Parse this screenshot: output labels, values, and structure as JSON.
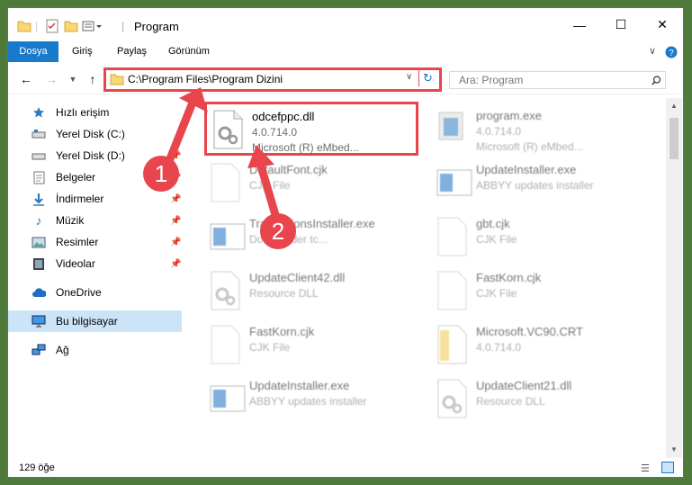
{
  "window": {
    "title": "Program"
  },
  "ribbon": {
    "tabs": [
      "Dosya",
      "Giriş",
      "Paylaş",
      "Görünüm"
    ]
  },
  "address": {
    "path": "C:\\Program Files\\Program Dizini"
  },
  "search": {
    "placeholder": "Ara: Program"
  },
  "sidebar": {
    "items": [
      {
        "label": "Hızlı erişim",
        "icon": "star-icon"
      },
      {
        "label": "Yerel Disk (C:)",
        "icon": "drive-icon"
      },
      {
        "label": "Yerel Disk (D:)",
        "icon": "drive-icon"
      },
      {
        "label": "Belgeler",
        "icon": "documents-icon"
      },
      {
        "label": "İndirmeler",
        "icon": "download-icon"
      },
      {
        "label": "Müzik",
        "icon": "music-icon"
      },
      {
        "label": "Resimler",
        "icon": "pictures-icon"
      },
      {
        "label": "Videolar",
        "icon": "video-icon"
      },
      {
        "label": "OneDrive",
        "icon": "cloud-icon"
      },
      {
        "label": "Bu bilgisayar",
        "icon": "computer-icon"
      },
      {
        "label": "Ağ",
        "icon": "network-icon"
      }
    ]
  },
  "files": [
    {
      "name": "odcefppc.dll",
      "line2": "4.0.714.0",
      "line3": "Microsoft (R) eMbed...",
      "highlight": true
    },
    {
      "name": "program.exe",
      "line2": "4.0.714.0",
      "line3": "Microsoft (R) eMbed..."
    },
    {
      "name": "DefaultFont.cjk",
      "line2": "CJK File",
      "line3": ""
    },
    {
      "name": "UpdateInstaller.exe",
      "line2": "ABBYY updates installer",
      "line3": ""
    },
    {
      "name": "TranslationsInstaller.exe",
      "line2": "Downloader tc...",
      "line3": ""
    },
    {
      "name": "gbt.cjk",
      "line2": "CJK File",
      "line3": ""
    },
    {
      "name": "UpdateClient42.dll",
      "line2": "Resource DLL",
      "line3": ""
    },
    {
      "name": "FastKorn.cjk",
      "line2": "CJK File",
      "line3": ""
    },
    {
      "name": "FastKorn.cjk",
      "line2": "CJK File",
      "line3": ""
    },
    {
      "name": "Microsoft.VC90.CRT",
      "line2": "4.0.714.0",
      "line3": ""
    },
    {
      "name": "UpdateInstaller.exe",
      "line2": "ABBYY updates installer",
      "line3": ""
    },
    {
      "name": "UpdateClient21.dll",
      "line2": "Resource DLL",
      "line3": ""
    }
  ],
  "status": {
    "count": "129 öğe"
  },
  "annotations": {
    "badge1": "1",
    "badge2": "2"
  }
}
